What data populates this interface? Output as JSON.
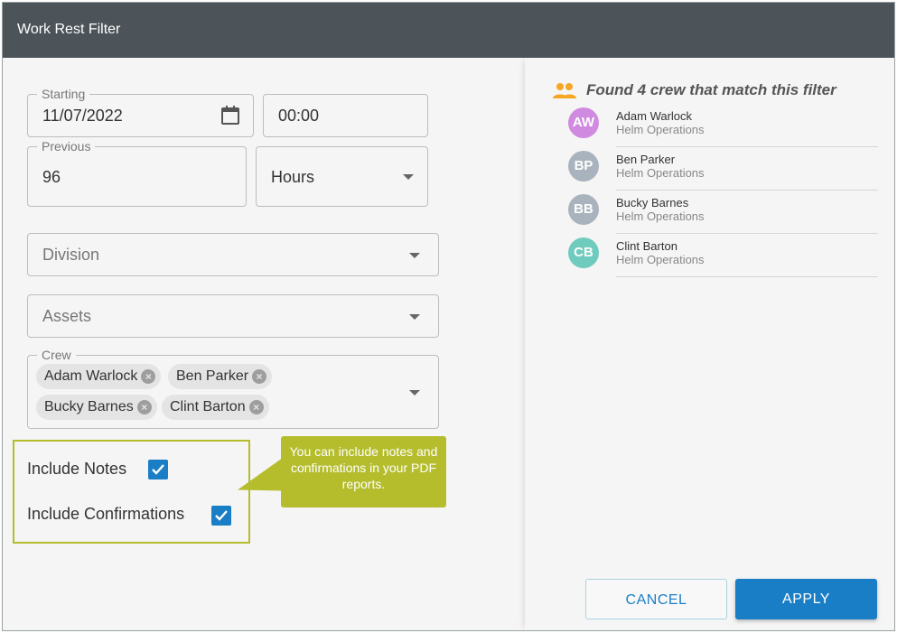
{
  "window": {
    "title": "Work Rest Filter"
  },
  "form": {
    "starting": {
      "label": "Starting",
      "date": "11/07/2022",
      "time": "00:00"
    },
    "previous": {
      "label": "Previous",
      "value": "96",
      "unit": "Hours"
    },
    "division": {
      "placeholder": "Division"
    },
    "assets": {
      "placeholder": "Assets"
    },
    "crew": {
      "label": "Crew",
      "chips": [
        "Adam Warlock",
        "Ben Parker",
        "Bucky Barnes",
        "Clint Barton"
      ]
    },
    "include_notes": {
      "label": "Include Notes",
      "checked": true
    },
    "include_confirmations": {
      "label": "Include Confirmations",
      "checked": true
    }
  },
  "callout": {
    "text": "You can include notes and confirmations in your PDF reports."
  },
  "results": {
    "summary": "Found 4 crew that match this filter",
    "icon": "people-icon",
    "crew": [
      {
        "initials": "AW",
        "name": "Adam Warlock",
        "role": "Helm Operations",
        "color": "#d08ae0"
      },
      {
        "initials": "BP",
        "name": "Ben Parker",
        "role": "Helm Operations",
        "color": "#a8b3bd"
      },
      {
        "initials": "BB",
        "name": "Bucky Barnes",
        "role": "Helm Operations",
        "color": "#a8b3bd"
      },
      {
        "initials": "CB",
        "name": "Clint Barton",
        "role": "Helm Operations",
        "color": "#6fcbbd"
      }
    ]
  },
  "actions": {
    "cancel": "CANCEL",
    "apply": "APPLY"
  },
  "colors": {
    "accent": "#1a7ec6",
    "titlebar": "#4d5459",
    "highlight": "#b5bd2c",
    "people_icon": "#f5a623"
  }
}
